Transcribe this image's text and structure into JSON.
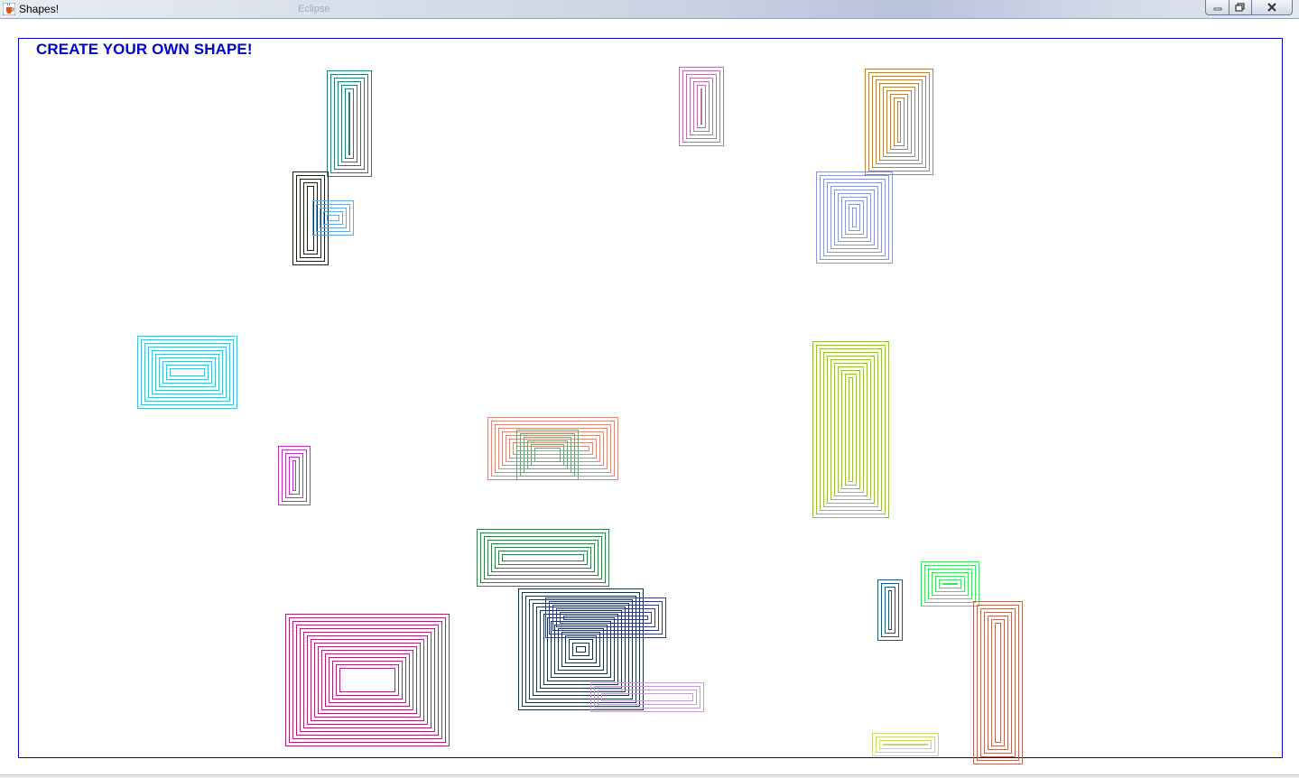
{
  "window": {
    "title": "Shapes!",
    "title_ghost": "Eclipse",
    "icon": "java-cup-icon",
    "controls": {
      "minimize_icon": "minimize-icon",
      "maximize_icon": "maximize-icon",
      "close_icon": "close-icon"
    }
  },
  "heading": {
    "text": "CREATE YOUR OWN SHAPE!",
    "color": "#0000cc"
  },
  "frame_color": "#0000cc"
}
